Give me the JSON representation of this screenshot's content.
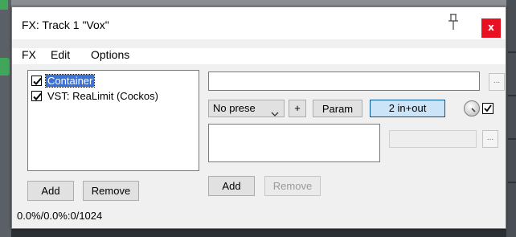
{
  "window": {
    "title": "FX: Track 1 \"Vox\"",
    "close_label": "x"
  },
  "menu": [
    "FX",
    "Edit",
    "Options"
  ],
  "fx_chain": [
    {
      "label": "Container",
      "checked": true,
      "selected": true
    },
    {
      "label": "VST: ReaLimit (Cockos)",
      "checked": true,
      "selected": false
    }
  ],
  "left_buttons": {
    "add": "Add",
    "remove": "Remove"
  },
  "status": "0.0%/0.0%:0/1024",
  "plugin_panel": {
    "name_value": "",
    "browse_label": "...",
    "preset_value": "No prese",
    "plus_label": "+",
    "param_label": "Param",
    "io_label": "2 in+out",
    "param_browse_label": "...",
    "add_label": "Add",
    "remove_label": "Remove",
    "bypass_checked": true
  }
}
